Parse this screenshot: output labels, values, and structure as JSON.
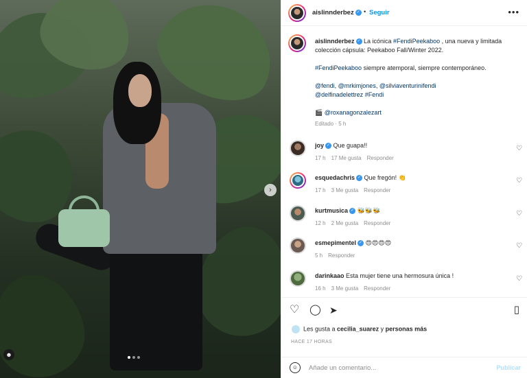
{
  "post": {
    "username": "aislinnderbez",
    "follow_label": "Seguir",
    "more_label": "•••",
    "carousel_next": "›",
    "tag_icon": "person"
  },
  "caption": {
    "username": "aislinnderbez",
    "line1_a": " La icónica ",
    "tag1": "#FendiPeekaboo",
    "line1_b": " , una nueva y limitada colección cápsula: Peekaboo Fall/Winter 2022.",
    "tag2": "#FendiPeekaboo",
    "line2_b": " siempre atemporal, siempre contemporáneo.",
    "mention1": "@fendi",
    "mention2": "@mrkimjones",
    "mention3": "@silviaventurinifendi",
    "mention4": "@delfinadelettrez",
    "tag3": "#Fendi",
    "credit_icon": "🎬",
    "credit": "@roxanagonzalezart",
    "meta": "Editado · 5 h"
  },
  "comments": [
    {
      "user": "joy",
      "verified": true,
      "text": "Que guapa!!",
      "time": "17 h",
      "likes": "17 Me gusta",
      "reply": "Responder",
      "story_ring": false
    },
    {
      "user": "esquedachris",
      "verified": true,
      "text": "Que fregón! 👏",
      "time": "17 h",
      "likes": "3 Me gusta",
      "reply": "Responder",
      "story_ring": true
    },
    {
      "user": "kurtmusica",
      "verified": true,
      "text": "🐝🐝🐝",
      "time": "12 h",
      "likes": "2 Me gusta",
      "reply": "Responder",
      "story_ring": false
    },
    {
      "user": "esmepimentel",
      "verified": true,
      "text": "😍😍😍😍",
      "time": "5 h",
      "likes": "",
      "reply": "Responder",
      "story_ring": false
    },
    {
      "user": "darinkaao",
      "verified": false,
      "text": "Esta mujer tiene una hermosura única !",
      "time": "16 h",
      "likes": "3 Me gusta",
      "reply": "Responder",
      "story_ring": false
    }
  ],
  "actions": {
    "like_icon": "♡",
    "comment_icon": "◯",
    "share_icon": "➤",
    "save_icon": "▯"
  },
  "likes": {
    "prefix": "Les gusta a ",
    "user": "cecilia_suarez",
    "suffix": " y ",
    "others": "personas más"
  },
  "time_ago": "HACE 17 HORAS",
  "composer": {
    "placeholder": "Añade un comentario...",
    "post_label": "Publicar"
  },
  "colors": {
    "accent": "#0095f6",
    "verified": "#3897f0",
    "link": "#00376b",
    "muted": "#8e8e8e"
  }
}
